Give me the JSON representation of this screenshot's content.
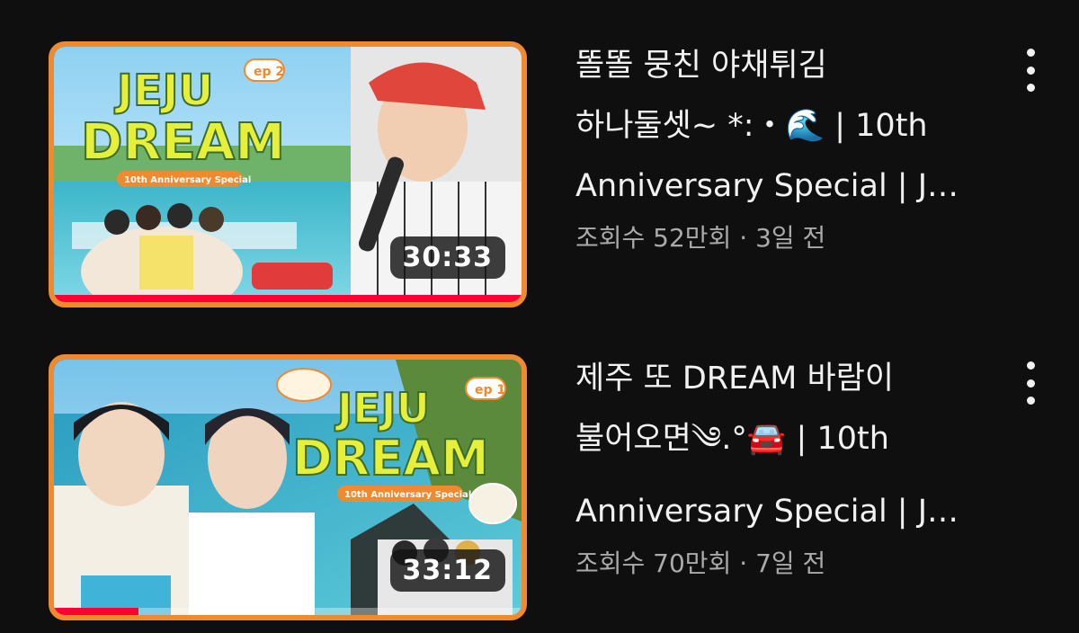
{
  "videos": [
    {
      "title_lines": [
        "똘똘 뭉친 야채튀김",
        "하나둘셋~ *:・🌊 | 10th",
        "Anniversary Special | J…"
      ],
      "views": "조회수 52만회",
      "separator": "·",
      "age": "3일 전",
      "duration": "30:33",
      "progress": 1.0,
      "thumbnail": {
        "logo_line1": "JEJU",
        "logo_line2": "DREAM",
        "episode_badge": "ep 2",
        "ribbon": "10th Anniversary Special"
      }
    },
    {
      "title_lines": [
        "제주 또 DREAM 바람이",
        "불어오면༄.°🚘 | 10th",
        "Anniversary Special | J…"
      ],
      "views": "조회수 70만회",
      "separator": "·",
      "age": "7일 전",
      "duration": "33:12",
      "progress": 0.18,
      "thumbnail": {
        "logo_line1": "JEJU",
        "logo_line2": "DREAM",
        "episode_badge": "ep 1",
        "ribbon": "10th Anniversary Special"
      }
    }
  ],
  "colors": {
    "background": "#0f0f0f",
    "progress_red": "#ff0033",
    "thumb_border": "#f08a2e",
    "logo_yellow": "#e6f03a"
  },
  "icons": {
    "more": "vertical-ellipsis-icon"
  }
}
